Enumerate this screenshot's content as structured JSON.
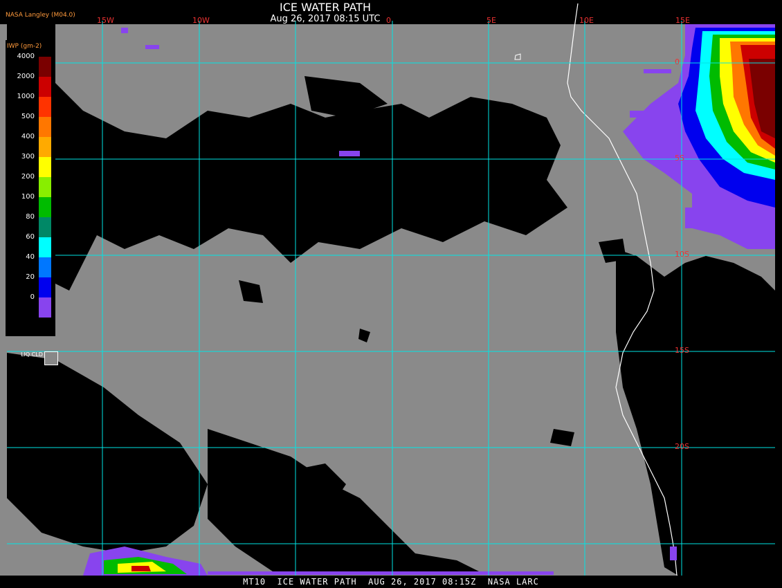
{
  "header": {
    "title": "ICE WATER PATH",
    "datetime": "Aug 26, 2017 08:15 UTC",
    "producer": "NASA Langley (M04.0)"
  },
  "footer": "MT10  ICE WATER PATH  AUG 26, 2017 08:15Z  NASA LARC",
  "grid": {
    "lon_labels": [
      "15W",
      "10W",
      "0",
      "5E",
      "10E",
      "15E"
    ],
    "lat_labels": [
      "0",
      "5S",
      "10S",
      "15S",
      "20S"
    ]
  },
  "legend": {
    "title": "IWP (gm-2)",
    "entries": [
      {
        "value": "4000",
        "color": "#7a0000"
      },
      {
        "value": "2000",
        "color": "#cc0000"
      },
      {
        "value": "1000",
        "color": "#ff3300"
      },
      {
        "value": "500",
        "color": "#ff7700"
      },
      {
        "value": "400",
        "color": "#ffaa00"
      },
      {
        "value": "300",
        "color": "#ffff00"
      },
      {
        "value": "200",
        "color": "#88ee00"
      },
      {
        "value": "100",
        "color": "#00bb00"
      },
      {
        "value": "80",
        "color": "#008866"
      },
      {
        "value": "60",
        "color": "#00ffff"
      },
      {
        "value": "40",
        "color": "#0077ff"
      },
      {
        "value": "20",
        "color": "#0000ee"
      },
      {
        "value": "0",
        "color": "#8844ee"
      }
    ],
    "liq_label": "LIQ CLD",
    "liq_color": "#888888"
  }
}
